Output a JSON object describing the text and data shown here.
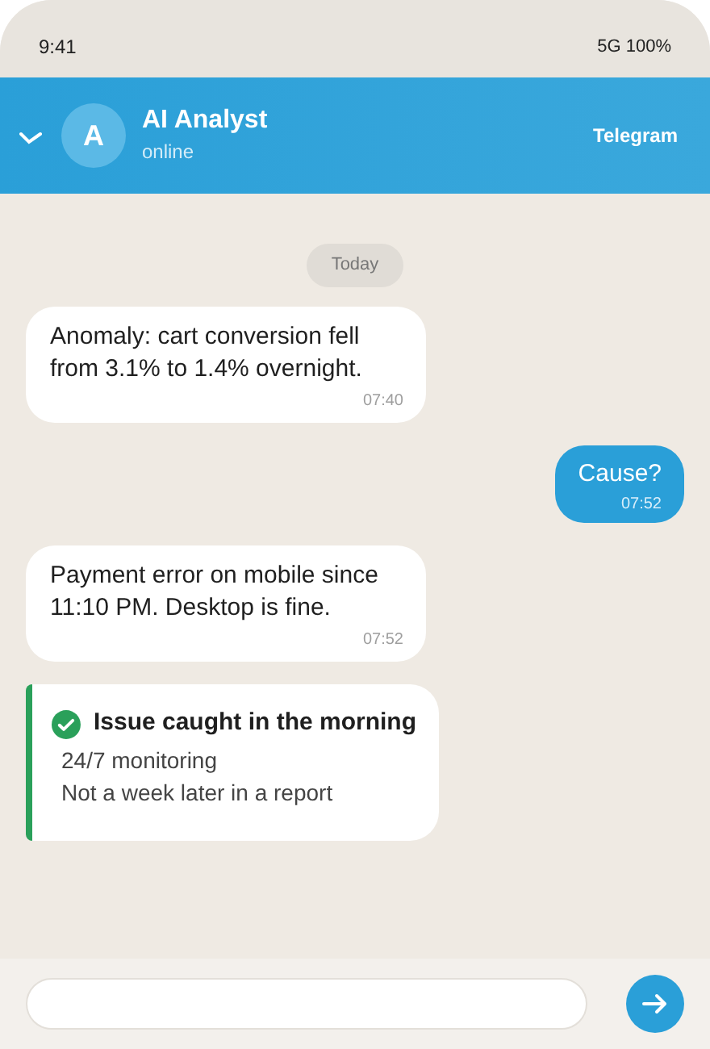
{
  "status_bar": {
    "time": "9:41",
    "indicators": "5G 100%"
  },
  "header": {
    "avatar_letter": "A",
    "name": "AI Analyst",
    "status": "online",
    "app": "Telegram"
  },
  "date_chip": "Today",
  "messages": [
    {
      "kind": "incoming",
      "text": "Anomaly: cart conversion fell from 3.1% to 1.4% overnight.",
      "time": "07:40"
    },
    {
      "kind": "outgoing",
      "text": "Cause?",
      "time": "07:52"
    },
    {
      "kind": "incoming",
      "text": "Payment error on mobile since 11:10 PM. Desktop is fine.",
      "time": "07:52"
    },
    {
      "kind": "highlight",
      "title": "Issue caught in the morning",
      "lines": [
        "24/7 monitoring",
        "Not a week later in a report"
      ]
    }
  ]
}
